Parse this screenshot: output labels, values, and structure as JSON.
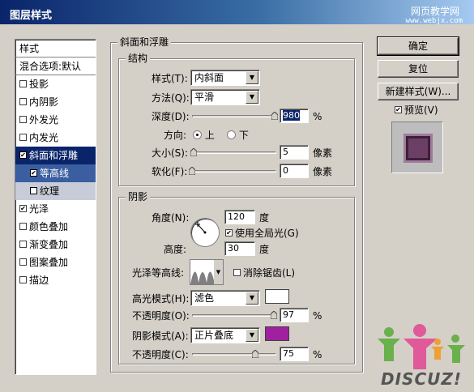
{
  "window": {
    "title": "图层样式",
    "watermark_top": "网页教学网",
    "watermark_bottom": "www.webjx.com"
  },
  "styles_panel": {
    "items": [
      {
        "label": "样式",
        "checked": null,
        "state": "header"
      },
      {
        "label": "混合选项:默认",
        "checked": null,
        "state": "header"
      },
      {
        "label": "投影",
        "checked": false,
        "state": "normal"
      },
      {
        "label": "内阴影",
        "checked": false,
        "state": "normal"
      },
      {
        "label": "外发光",
        "checked": false,
        "state": "normal"
      },
      {
        "label": "内发光",
        "checked": false,
        "state": "normal"
      },
      {
        "label": "斜面和浮雕",
        "checked": true,
        "state": "selected"
      },
      {
        "label": "等高线",
        "checked": true,
        "state": "sub-selected"
      },
      {
        "label": "纹理",
        "checked": false,
        "state": "sub"
      },
      {
        "label": "光泽",
        "checked": true,
        "state": "normal"
      },
      {
        "label": "颜色叠加",
        "checked": false,
        "state": "normal"
      },
      {
        "label": "渐变叠加",
        "checked": false,
        "state": "normal"
      },
      {
        "label": "图案叠加",
        "checked": false,
        "state": "normal"
      },
      {
        "label": "描边",
        "checked": false,
        "state": "normal"
      }
    ]
  },
  "bevel": {
    "group_title": "斜面和浮雕",
    "structure": {
      "title": "结构",
      "style_label": "样式(T):",
      "style_value": "内斜面",
      "technique_label": "方法(Q):",
      "technique_value": "平滑",
      "depth_label": "深度(D):",
      "depth_value": "980",
      "depth_fraction": 0.98,
      "percent": "%",
      "direction_label": "方向:",
      "dir_up": "上",
      "dir_down": "下",
      "direction_selected": "up",
      "size_label": "大小(S):",
      "size_value": "5",
      "size_fraction": 0.02,
      "pixels": "像素",
      "soften_label": "软化(F):",
      "soften_value": "0",
      "soften_fraction": 0.0
    },
    "shading": {
      "title": "阴影",
      "angle_label": "角度(N):",
      "angle_value": "120",
      "degree": "度",
      "global_light_label": "使用全局光(G)",
      "global_light_checked": true,
      "altitude_label": "高度:",
      "altitude_value": "30",
      "gloss_label": "光泽等高线:",
      "antialias_label": "消除锯齿(L)",
      "antialias_checked": false,
      "highlight_mode_label": "高光模式(H):",
      "highlight_mode_value": "滤色",
      "highlight_color": "#ffffff",
      "opacity1_label": "不透明度(O):",
      "opacity1_value": "97",
      "opacity1_fraction": 0.97,
      "shadow_mode_label": "阴影模式(A):",
      "shadow_mode_value": "正片叠底",
      "shadow_color": "#a020a0",
      "opacity2_label": "不透明度(C):",
      "opacity2_value": "75",
      "opacity2_fraction": 0.75
    }
  },
  "buttons": {
    "ok": "确定",
    "reset": "复位",
    "new_style": "新建样式(W)...",
    "preview_label": "预览(V)",
    "preview_checked": true
  },
  "logo_text": "DISCUZ!",
  "colors": {
    "selection": "#0a246a",
    "dialog_bg": "#d4d0c8",
    "logo_green": "#6ab04c",
    "logo_pink": "#e05a9a",
    "logo_orange": "#f0a030"
  }
}
